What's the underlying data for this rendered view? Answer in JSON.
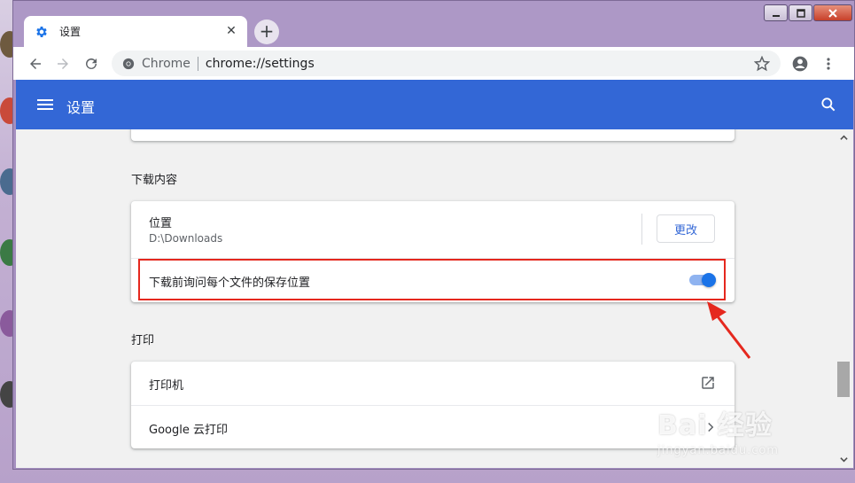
{
  "tab": {
    "title": "设置",
    "icon": "gear-icon",
    "new_tab_label": "+"
  },
  "toolbar": {
    "site_label": "Chrome",
    "url": "chrome://settings"
  },
  "header": {
    "title": "设置"
  },
  "downloads": {
    "section_title": "下载内容",
    "location_label": "位置",
    "location_value": "D:\\Downloads",
    "change_button": "更改",
    "ask_label": "下载前询问每个文件的保存位置",
    "ask_enabled": true
  },
  "printing": {
    "section_title": "打印",
    "printers_label": "打印机",
    "cloud_print_label": "Google 云打印"
  },
  "colors": {
    "accent": "#3367d6",
    "toggle": "#1a73e8",
    "highlight": "#e5281e"
  },
  "watermark": {
    "brand": "Bai 经验",
    "url": "jingyan.baidu.com"
  }
}
